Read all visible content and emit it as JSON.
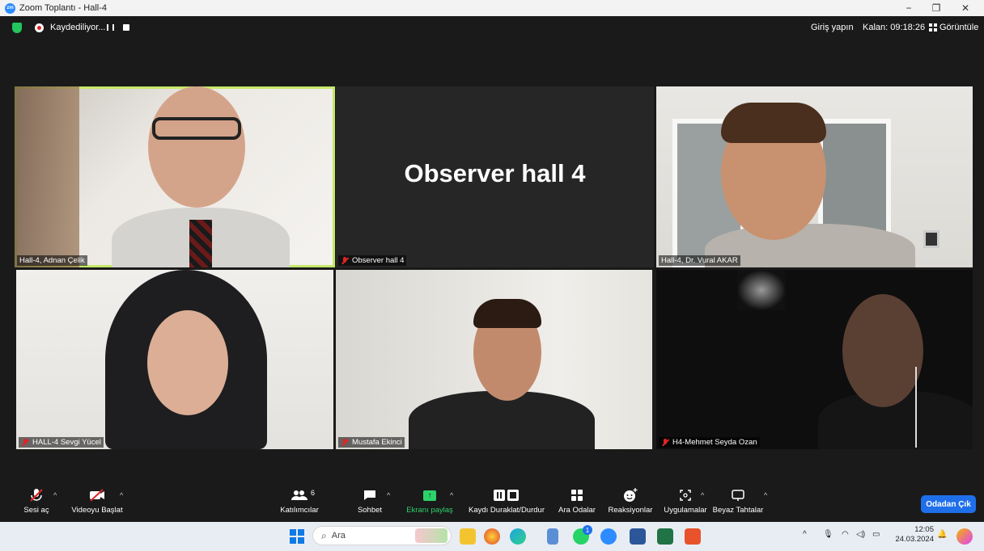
{
  "window": {
    "title": "Zoom Toplantı - Hall-4",
    "minimize": "−",
    "restore": "❐",
    "close": "✕"
  },
  "status": {
    "recording_text": "Kaydediliyor...",
    "signin": "Giriş yapın",
    "remaining": "Kalan: 09:18:26",
    "view": "Görüntüle"
  },
  "tiles": [
    {
      "name": "Hall-4, Adnan Çelik",
      "muted": false
    },
    {
      "name": "Observer hall 4",
      "display": "Observer hall 4",
      "muted": true
    },
    {
      "name": "Hall-4, Dr. Vural AKAR",
      "muted": false
    },
    {
      "name": "HALL-4 Sevgi Yücel",
      "muted": true
    },
    {
      "name": "Mustafa Ekinci",
      "muted": true
    },
    {
      "name": "H4-Mehmet Seyda Ozan",
      "muted": true
    }
  ],
  "toolbar": {
    "unmute": "Sesi aç",
    "start_video": "Videoyu Başlat",
    "participants": "Katılımcılar",
    "participants_count": "6",
    "chat": "Sohbet",
    "share": "Ekranı paylaş",
    "record": "Kaydı Duraklat/Durdur",
    "breakout": "Ara Odalar",
    "reactions": "Reaksiyonlar",
    "apps": "Uygulamalar",
    "whiteboard": "Beyaz Tahtalar",
    "leave": "Odadan Çık"
  },
  "taskbar": {
    "search_placeholder": "Ara",
    "time": "12:05",
    "date": "24.03.2024",
    "whatsapp_badge": "1"
  },
  "colors": {
    "active_speaker": "#c6e86a",
    "leave": "#1f6feb",
    "share_green": "#2bd36a",
    "muted_red": "#e02424"
  }
}
